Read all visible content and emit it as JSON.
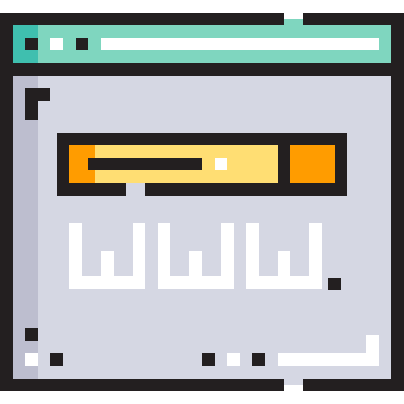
{
  "icon": {
    "name": "web-browser-icon",
    "logo_text": "www.",
    "colors": {
      "outline": "#231F20",
      "titlebar": "#7FD6BF",
      "titlebar_shade": "#3FBFAF",
      "window_body": "#D5D7E3",
      "window_shadow": "#BDBECF",
      "search_box": "#FFDE73",
      "search_accent": "#FF9C00",
      "highlight": "#FFFFFF"
    }
  }
}
